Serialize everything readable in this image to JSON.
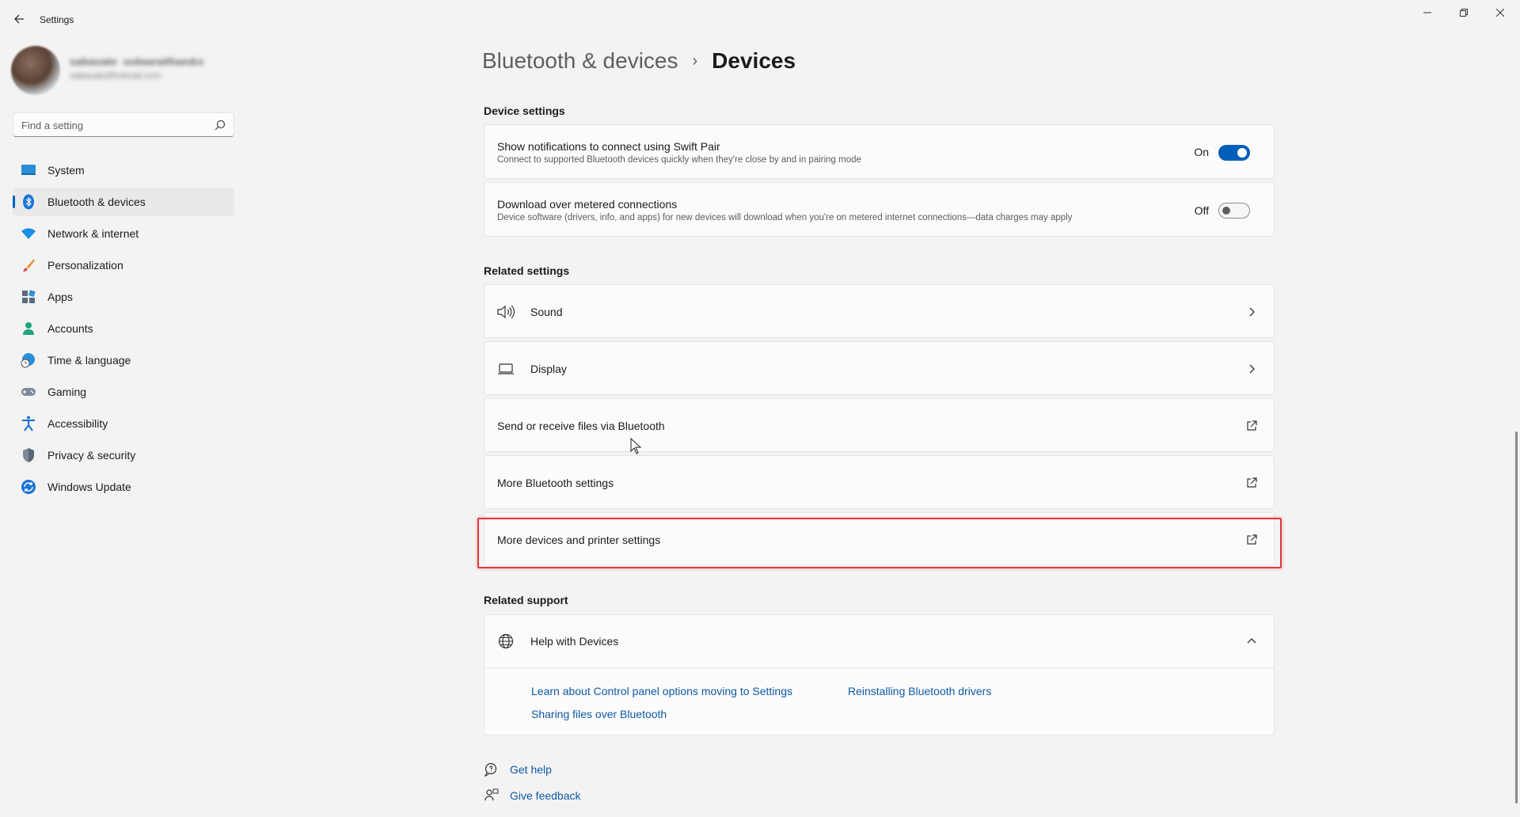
{
  "window": {
    "title": "Settings"
  },
  "profile": {
    "name": "sabayate_vulgaraithan&sbot",
    "email": "sabayate@hotmail.com"
  },
  "search": {
    "placeholder": "Find a setting",
    "value": ""
  },
  "sidebar": {
    "items": [
      {
        "label": "System",
        "icon": "system-icon",
        "selected": false
      },
      {
        "label": "Bluetooth & devices",
        "icon": "bluetooth-icon",
        "selected": true
      },
      {
        "label": "Network & internet",
        "icon": "wifi-icon",
        "selected": false
      },
      {
        "label": "Personalization",
        "icon": "brush-icon",
        "selected": false
      },
      {
        "label": "Apps",
        "icon": "apps-icon",
        "selected": false
      },
      {
        "label": "Accounts",
        "icon": "person-icon",
        "selected": false
      },
      {
        "label": "Time & language",
        "icon": "globe-clock-icon",
        "selected": false
      },
      {
        "label": "Gaming",
        "icon": "gamepad-icon",
        "selected": false
      },
      {
        "label": "Accessibility",
        "icon": "accessibility-icon",
        "selected": false
      },
      {
        "label": "Privacy & security",
        "icon": "shield-icon",
        "selected": false
      },
      {
        "label": "Windows Update",
        "icon": "update-icon",
        "selected": false
      }
    ]
  },
  "breadcrumb": {
    "parent": "Bluetooth & devices",
    "separator": "›",
    "current": "Devices"
  },
  "device_settings": {
    "heading": "Device settings",
    "swift_pair": {
      "title": "Show notifications to connect using Swift Pair",
      "description": "Connect to supported Bluetooth devices quickly when they're close by and in pairing mode",
      "state_label": "On",
      "on": true
    },
    "metered": {
      "title": "Download over metered connections",
      "description": "Device software (drivers, info, and apps) for new devices will download when you're on metered internet connections—data charges may apply",
      "state_label": "Off",
      "on": false
    }
  },
  "related_settings": {
    "heading": "Related settings",
    "sound": "Sound",
    "display": "Display",
    "send_receive": "Send or receive files via Bluetooth",
    "more_bluetooth": "More Bluetooth settings",
    "more_devices": "More devices and printer settings"
  },
  "related_support": {
    "heading": "Related support",
    "help_title": "Help with Devices",
    "links": {
      "control_panel": "Learn about Control panel options moving to Settings",
      "reinstall": "Reinstalling Bluetooth drivers",
      "sharing": "Sharing files over Bluetooth"
    }
  },
  "footer": {
    "get_help": "Get help",
    "give_feedback": "Give feedback"
  },
  "colors": {
    "accent": "#005fb8",
    "link": "#0f5aa6",
    "highlight": "#e0383e",
    "background": "#f3f3f3",
    "card": "#fbfbfb"
  }
}
